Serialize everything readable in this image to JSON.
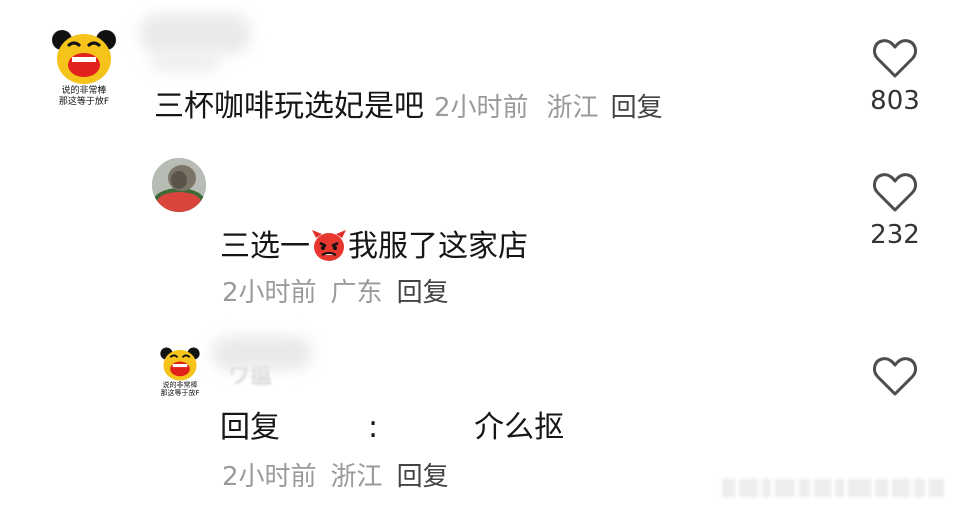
{
  "comments": [
    {
      "avatar_caption": [
        "说的非常棒",
        "那这等于放F"
      ],
      "text": "三杯咖啡玩选妃是吧",
      "time": "2小时前",
      "location": "浙江",
      "reply": "回复",
      "likes": "803"
    },
    {
      "text_before": "三选一",
      "emoji": "devil-emoji",
      "text_after": "我服了这家店",
      "time": "2小时前",
      "location": "广东",
      "reply": "回复",
      "likes": "232"
    },
    {
      "avatar_caption": [
        "说的非常棒",
        "那这等于放F"
      ],
      "name_fragment": "ワ瘟",
      "reply_prefix": "回复",
      "colon": ":",
      "text": "介么抠",
      "time": "2小时前",
      "location": "浙江",
      "reply": "回复",
      "likes": ""
    }
  ],
  "colors": {
    "text": "#161616",
    "meta": "#9a9a9a",
    "heart": "#4d4d4d",
    "meme_yellow": "#f6c31a",
    "meme_mouth": "#e0211c"
  }
}
